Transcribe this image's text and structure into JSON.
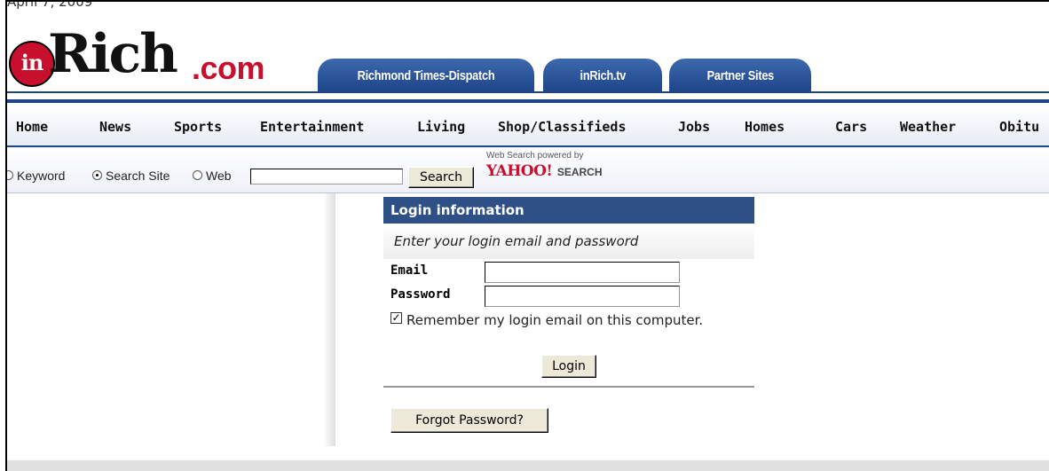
{
  "page": {
    "date": "April 7, 2009"
  },
  "logo": {
    "badge": "in",
    "name": "Rich",
    "suffix": ".com"
  },
  "tabs": [
    {
      "label": "Richmond Times-Dispatch"
    },
    {
      "label": "inRich.tv"
    },
    {
      "label": "Partner Sites"
    }
  ],
  "nav": {
    "items": [
      {
        "label": "Home"
      },
      {
        "label": "News"
      },
      {
        "label": "Sports"
      },
      {
        "label": "Entertainment"
      },
      {
        "label": "Living"
      },
      {
        "label": "Shop/Classifieds"
      },
      {
        "label": "Jobs"
      },
      {
        "label": "Homes"
      },
      {
        "label": "Cars"
      },
      {
        "label": "Weather"
      },
      {
        "label": "Obitu"
      }
    ]
  },
  "search": {
    "options": [
      {
        "label": "Keyword",
        "checked": false
      },
      {
        "label": "Search Site",
        "checked": true
      },
      {
        "label": "Web",
        "checked": false
      }
    ],
    "value": "",
    "button_label": "Search",
    "powered_by": "Web Search powered by",
    "provider": "YAHOO!",
    "provider_suffix": "SEARCH"
  },
  "login": {
    "header": "Login information",
    "instruction": "Enter your login email and password",
    "email_label": "Email",
    "email_value": "",
    "password_label": "Password",
    "password_value": "",
    "remember_checked": true,
    "remember_label": "Remember my login email on this computer.",
    "login_button": "Login",
    "forgot_button": "Forgot Password?"
  },
  "colors": {
    "brand_red": "#c8102e",
    "brand_blue": "#1e4489",
    "header_blue": "#2f5087"
  }
}
